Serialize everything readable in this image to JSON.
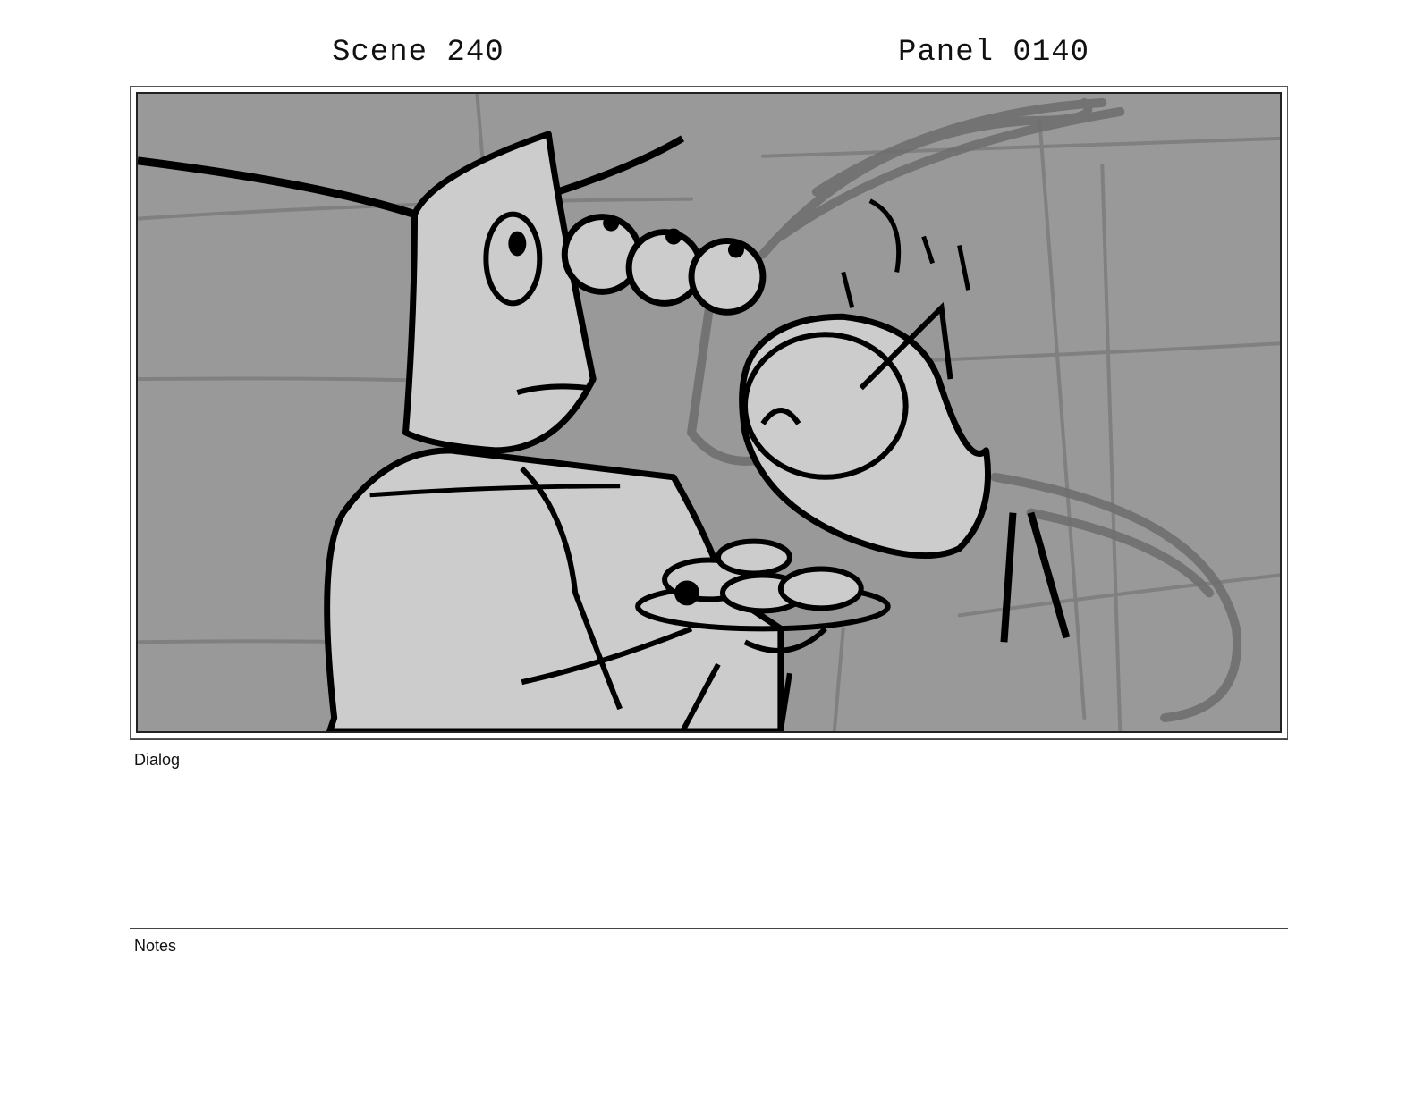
{
  "header": {
    "scene": "Scene 240",
    "panel": "Panel 0140"
  },
  "panel_image": {
    "subject": "storyboard-sketch",
    "colors": {
      "background": "#999999",
      "figure_fill": "#cccccc",
      "ink": "#000000",
      "rough": "#7a7a7a"
    }
  },
  "sections": {
    "dialog_label": "Dialog",
    "notes_label": "Notes"
  }
}
